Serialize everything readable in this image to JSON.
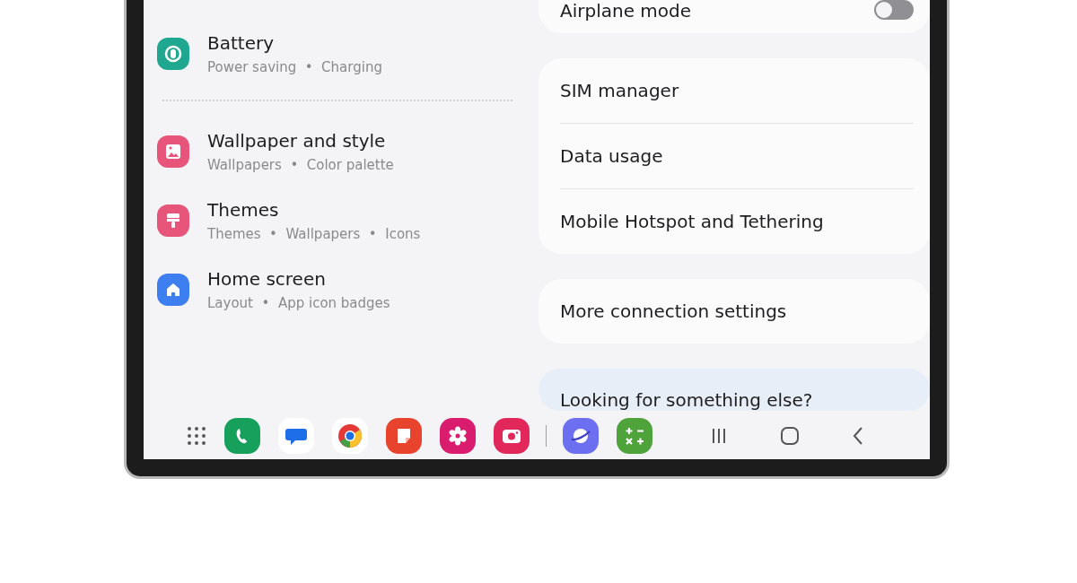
{
  "left_groups": [
    {
      "items": [
        {
          "kind": "battery",
          "color": "#1fa88f",
          "title": "Battery",
          "subtitle": "Power saving  •  Charging"
        }
      ]
    },
    {
      "items": [
        {
          "kind": "wallpaper",
          "color": "#e8557a",
          "title": "Wallpaper and style",
          "subtitle": "Wallpapers  •  Color palette"
        },
        {
          "kind": "themes",
          "color": "#e8557a",
          "title": "Themes",
          "subtitle": "Themes  •  Wallpapers  •  Icons"
        },
        {
          "kind": "home",
          "color": "#3d7ef0",
          "title": "Home screen",
          "subtitle": "Layout  •  App icon badges"
        }
      ]
    }
  ],
  "right_cards": [
    {
      "kind": "plain",
      "rows": [
        {
          "kind": "toggle",
          "label": "Airplane mode",
          "on": false
        }
      ]
    },
    {
      "kind": "plain",
      "rows": [
        {
          "kind": "link",
          "label": "SIM manager"
        },
        {
          "kind": "link",
          "label": "Data usage"
        },
        {
          "kind": "link",
          "label": "Mobile Hotspot and Tethering"
        }
      ]
    },
    {
      "kind": "plain",
      "rows": [
        {
          "kind": "link",
          "label": "More connection settings"
        }
      ]
    },
    {
      "kind": "suggestion",
      "rows": [
        {
          "kind": "link",
          "label": "Looking for something else?"
        }
      ]
    }
  ],
  "dock": {
    "pinned": [
      {
        "kind": "phone",
        "color": "#17a05b"
      },
      {
        "kind": "messages",
        "color": "#ffffff"
      },
      {
        "kind": "browser",
        "color": "#ffffff"
      },
      {
        "kind": "notes",
        "color": "#e8432d"
      },
      {
        "kind": "flower",
        "color": "#d91c6e"
      },
      {
        "kind": "camera",
        "color": "#e2285a"
      }
    ],
    "recent": [
      {
        "kind": "planet",
        "color": "#6b6ff0"
      },
      {
        "kind": "calculator",
        "color": "#4ea33a"
      }
    ]
  }
}
